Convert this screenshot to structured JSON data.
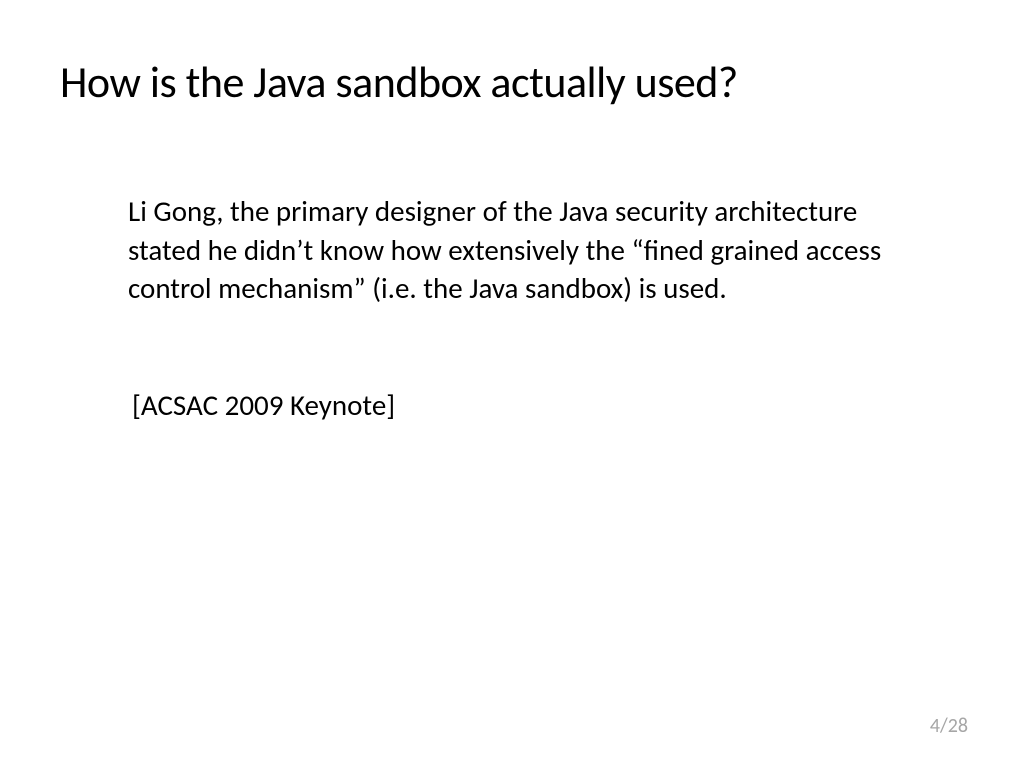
{
  "slide": {
    "title": "How is the Java sandbox actually used?",
    "body": "Li Gong, the primary designer of the Java security architecture stated he didn’t know how  extensively the “fined grained access control mechanism” (i.e. the Java sandbox) is used.",
    "citation": "[ACSAC 2009 Keynote]",
    "page_number": "4/28"
  }
}
